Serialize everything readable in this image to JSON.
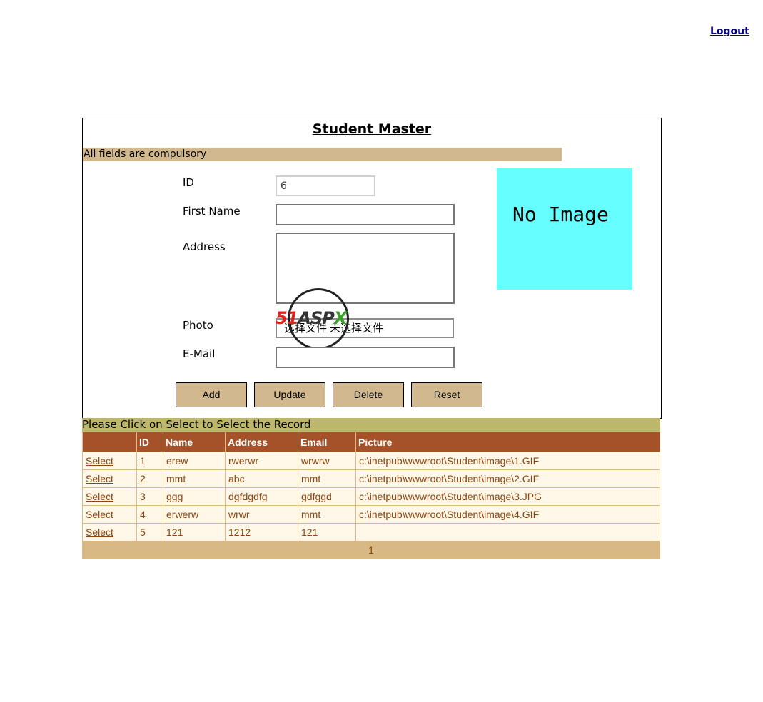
{
  "header": {
    "logout_label": "Logout"
  },
  "form": {
    "title": "Student Master",
    "notice": "All fields are compulsory",
    "labels": {
      "id": "ID",
      "first_name": "First Name",
      "address": "Address",
      "photo": "Photo",
      "email": "E-Mail"
    },
    "values": {
      "id": "6",
      "first_name": "",
      "address": "",
      "email": ""
    },
    "file_input": {
      "choose_label": "选择文件",
      "status": "未选择文件"
    },
    "image_placeholder": "No Image",
    "buttons": {
      "add": "Add",
      "update": "Update",
      "delete": "Delete",
      "reset": "Reset"
    }
  },
  "watermark": {
    "part1": "51",
    "part2": "ASP",
    "part3": "X"
  },
  "grid": {
    "caption": "Please Click on Select to Select the Record",
    "columns": [
      "",
      "ID",
      "Name",
      "Address",
      "Email",
      "Picture"
    ],
    "select_label": "Select",
    "rows": [
      {
        "id": "1",
        "name": "erew",
        "address": "rwerwr",
        "email": "wrwrw",
        "picture": "c:\\inetpub\\wwwroot\\Student\\image\\1.GIF"
      },
      {
        "id": "2",
        "name": "mmt",
        "address": "abc",
        "email": "mmt",
        "picture": "c:\\inetpub\\wwwroot\\Student\\image\\2.GIF"
      },
      {
        "id": "3",
        "name": "ggg",
        "address": "dgfdgdfg",
        "email": "gdfggd",
        "picture": "c:\\inetpub\\wwwroot\\Student\\image\\3.JPG"
      },
      {
        "id": "4",
        "name": "erwerw",
        "address": "wrwr",
        "email": "mmt",
        "picture": "c:\\inetpub\\wwwroot\\Student\\image\\4.GIF"
      },
      {
        "id": "5",
        "name": "121",
        "address": "1212",
        "email": "121",
        "picture": ""
      }
    ],
    "pager": "1"
  },
  "colors": {
    "notice_bg": "#D1B88E",
    "caption_bg": "#BDB76B",
    "header_bg": "#A55129",
    "row_bg": "#FFF7E7",
    "row_text": "#8C4510",
    "pager_bg": "#D8B984",
    "no_image_bg": "#66FFFF"
  }
}
